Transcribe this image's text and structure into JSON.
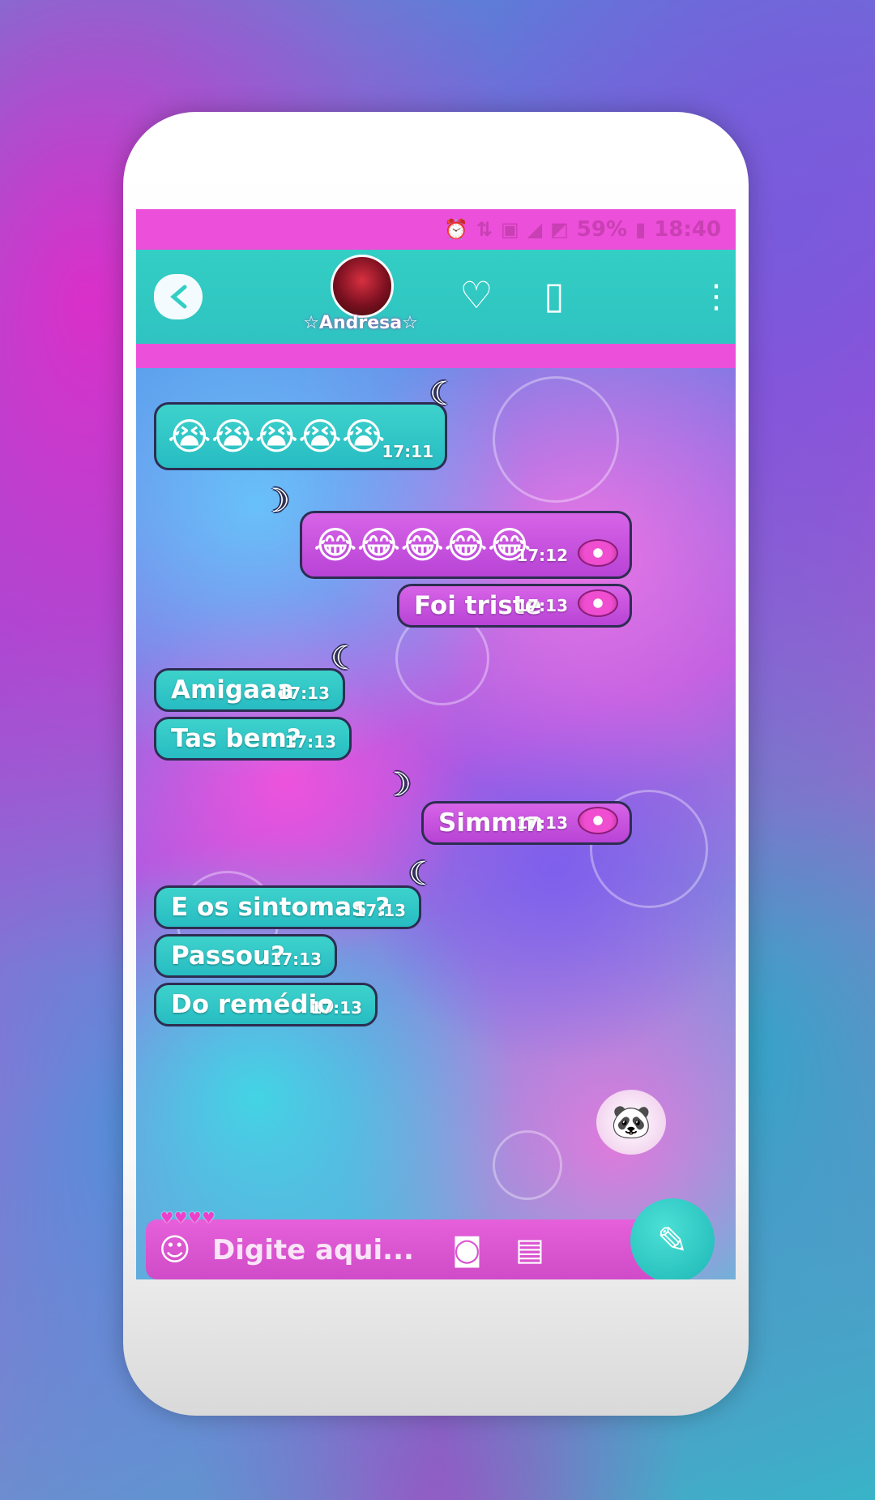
{
  "status_bar": {
    "icons": [
      "alarm-icon",
      "data-icon",
      "nfc-icon",
      "signal-icon",
      "signal2-icon",
      "battery-icon"
    ],
    "battery": "59%",
    "time": "18:40"
  },
  "header": {
    "contact_name": "☆Andresa☆",
    "icons": [
      "back-icon",
      "balloon-icon",
      "phone-icon",
      "menu-icon"
    ]
  },
  "messages": [
    {
      "dir": "in",
      "type": "emoji",
      "emoji": "😭😭😭😭😭",
      "time": "17:11"
    },
    {
      "dir": "out",
      "type": "emoji",
      "emoji": "😂😂😂😂😂",
      "time": "17:12"
    },
    {
      "dir": "out",
      "type": "text",
      "text": "Foi triste",
      "time": "17:13"
    },
    {
      "dir": "in",
      "type": "text",
      "text": "Amigaaa",
      "time": "17:13"
    },
    {
      "dir": "in",
      "type": "text",
      "text": "Tas bem?",
      "time": "17:13"
    },
    {
      "dir": "out",
      "type": "text",
      "text": "Simmm",
      "time": "17:13"
    },
    {
      "dir": "in",
      "type": "text",
      "text": "E os sintomas ?",
      "time": "17:13"
    },
    {
      "dir": "in",
      "type": "text",
      "text": "Passou?",
      "time": "17:13"
    },
    {
      "dir": "in",
      "type": "text",
      "text": "Do remédio",
      "time": "17:13"
    }
  ],
  "composer": {
    "placeholder": "Digite aqui...",
    "icons": [
      "sticker-icon",
      "camera-icon",
      "gallery-icon",
      "send-icon"
    ]
  },
  "colors": {
    "accent_teal": "#33cec4",
    "accent_pink": "#ec4fd9",
    "bubble_in": "#3ed2cc",
    "bubble_out": "#c554df"
  }
}
